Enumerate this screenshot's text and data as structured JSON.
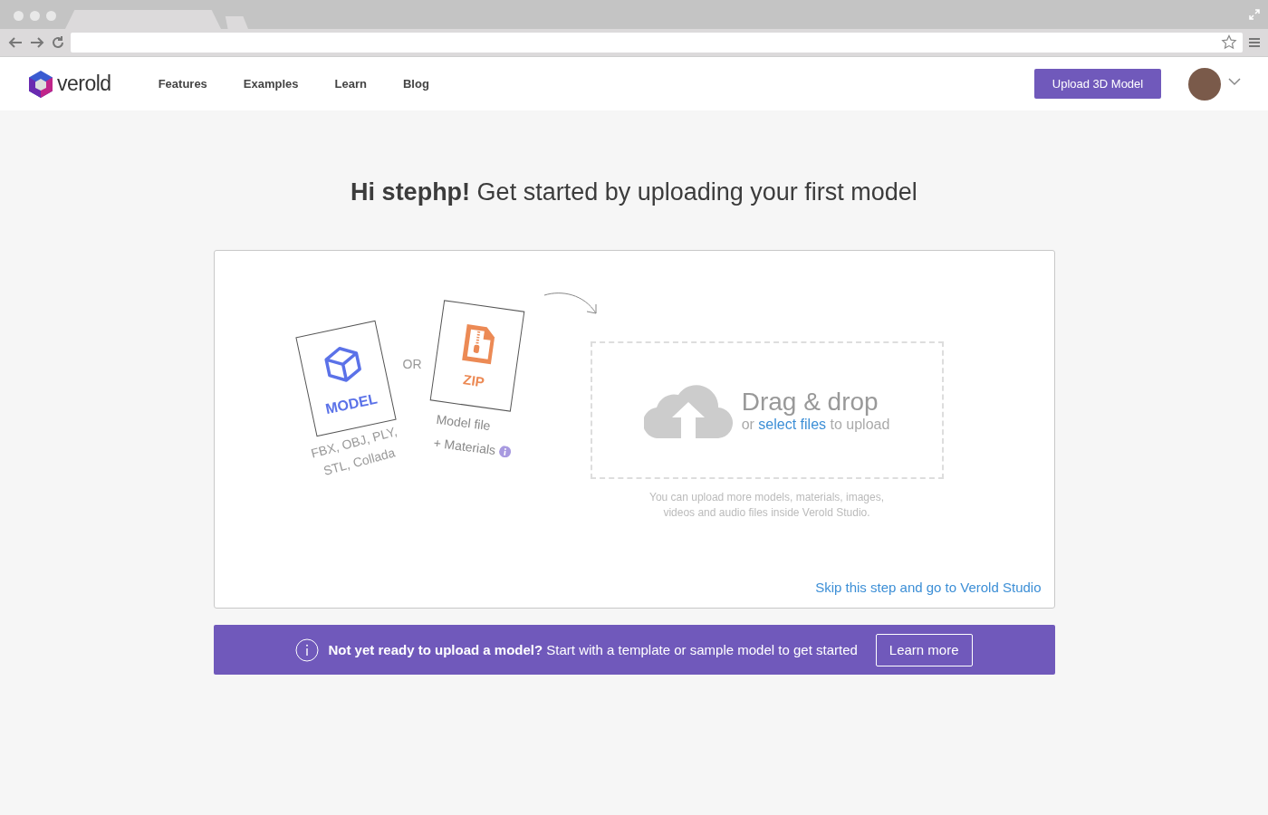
{
  "nav": {
    "logo": "verold",
    "links": [
      {
        "label": "Features"
      },
      {
        "label": "Examples"
      },
      {
        "label": "Learn"
      },
      {
        "label": "Blog"
      }
    ],
    "upload_button": "Upload 3D Model"
  },
  "heading": "**Hi stephp!** Get started by uploading your first model",
  "upload": {
    "model_card": {
      "label": "MODEL",
      "formats": "FBX, OBJ, PLY,\nSTL, Collada"
    },
    "or": "OR",
    "zip_card": {
      "label": "ZIP",
      "line_1": "Model file",
      "line_2": "+ Materials"
    },
    "dropzone": {
      "title": "Drag & drop",
      "before": "or",
      "link": "select files",
      "after": "to upload"
    },
    "note": "You can upload more models, materials, images,\nvideos and audio files inside Verold Studio.",
    "skip_link": "Skip this step and go to Verold Studio"
  },
  "banner": {
    "text": "**Not yet ready to upload a model?** Start with a template or sample model to get started",
    "button": "Learn more"
  }
}
